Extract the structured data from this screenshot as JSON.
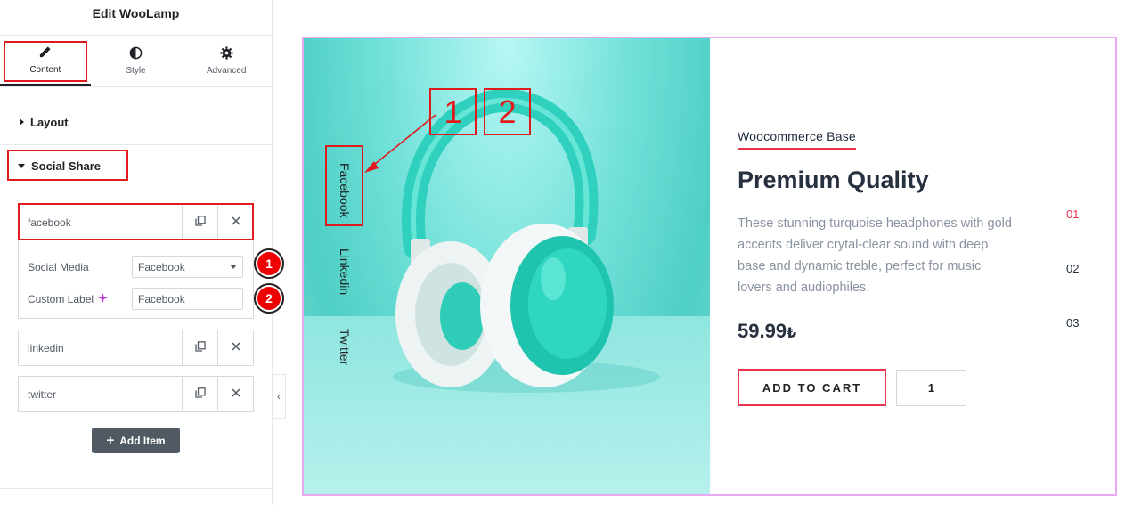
{
  "panel": {
    "title": "Edit WooLamp",
    "tabs": [
      {
        "label": "Content",
        "icon": "pencil-icon"
      },
      {
        "label": "Style",
        "icon": "half-circle-icon"
      },
      {
        "label": "Advanced",
        "icon": "gear-icon"
      }
    ],
    "sections": {
      "layout": "Layout",
      "social_share": "Social Share"
    },
    "items": [
      {
        "title": "facebook"
      },
      {
        "title": "linkedin"
      },
      {
        "title": "twitter"
      }
    ],
    "controls": {
      "social_media_label": "Social Media",
      "social_media_value": "Facebook",
      "custom_label_label": "Custom Label",
      "custom_label_value": "Facebook"
    },
    "add_item_label": "Add Item",
    "badges": [
      "1",
      "2"
    ]
  },
  "preview": {
    "social_links": [
      "Facebook",
      "Linkedin",
      "Twitter"
    ],
    "callouts": [
      "1",
      "2"
    ],
    "kicker": "Woocommerce Base",
    "title": "Premium Quality",
    "description": "These stunning turquoise headphones with gold accents deliver crytal-clear sound with deep base and dynamic treble, perfect for music lovers and audiophiles.",
    "price": "59.99",
    "currency": "₺",
    "add_to_cart": "ADD TO CART",
    "quantity": "1",
    "slides": [
      "01",
      "02",
      "03"
    ],
    "active_slide": "01"
  },
  "colors": {
    "accent": "#e8354f",
    "highlight": "#e01b1b",
    "frame": "#e9a8f2",
    "panel_button": "#515962",
    "turquoise": "#4fcfc4"
  }
}
